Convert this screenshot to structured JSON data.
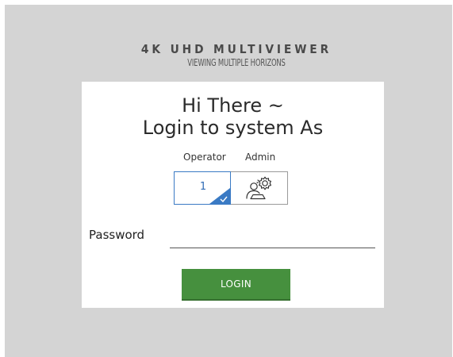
{
  "brand": {
    "title": "4K UHD MULTIVIEWER",
    "subtitle": "VIEWING MULTIPLE HORIZONS"
  },
  "greeting": {
    "line1": "Hi There ~",
    "line2": "Login to system As"
  },
  "roles": [
    {
      "label": "Operator",
      "value": "1",
      "selected": true
    },
    {
      "label": "Admin",
      "icon": "admin-settings-icon",
      "selected": false
    }
  ],
  "password": {
    "label": "Password",
    "value": ""
  },
  "login_button": "LOGIN",
  "colors": {
    "background": "#d4d4d4",
    "card": "#ffffff",
    "accent_blue": "#3a7ac4",
    "login_green": "#46903e"
  }
}
